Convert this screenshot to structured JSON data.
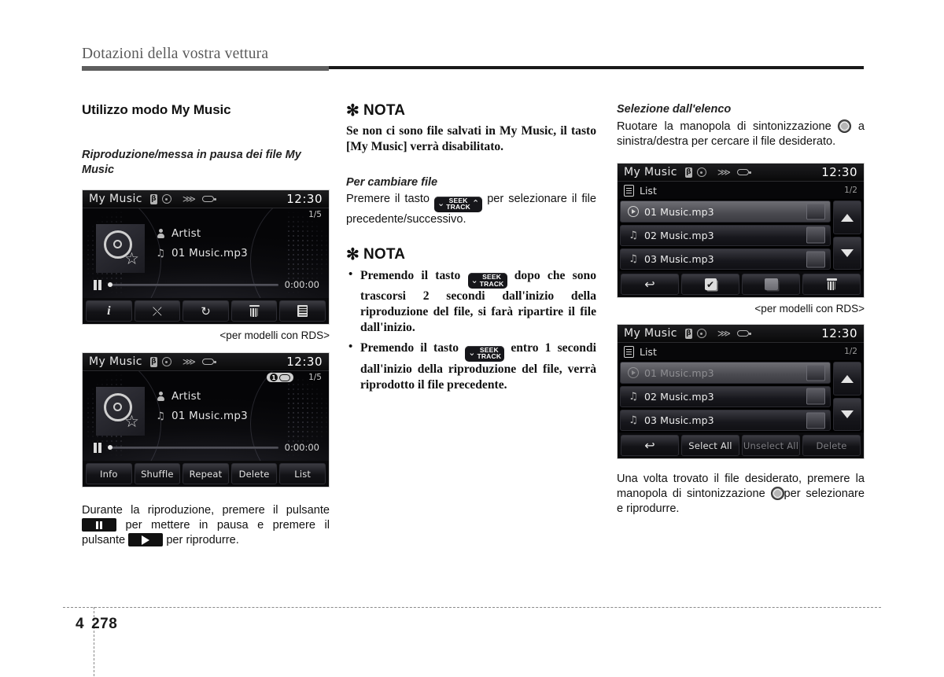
{
  "header": {
    "title": "Dotazioni della vostra vettura"
  },
  "footer": {
    "section": "4",
    "page": "278"
  },
  "left": {
    "section_title": "Utilizzo modo My Music",
    "sub_title": "Riproduzione/messa in pausa dei file My Music",
    "caption_rds": "<per modelli con RDS>",
    "bottom_text_1": "Durante la riproduzione, premere il pulsante",
    "bottom_text_2": "per mettere in pausa e premere il pulsante",
    "bottom_text_3": "per riprodurre."
  },
  "middle": {
    "nota1_label": "NOTA",
    "nota1_text": "Se non ci sono file salvati in My Music, il tasto [My Music] verrà disabilitato.",
    "sub_title": "Per cambiare file",
    "change_text_1": "Premere il tasto",
    "change_text_2": "per selezionare il file precedente/successivo.",
    "nota2_label": "NOTA",
    "bullet1_a": "Premendo il tasto",
    "bullet1_b": "dopo che sono trascorsi 2 secondi dall'inizio della riproduzione del file, si farà ripartire il file dall'inizio.",
    "bullet2_a": "Premendo il tasto",
    "bullet2_b": "entro 1 secondi dall'inizio della riproduzione del file, verrà riprodotto il file precedente.",
    "seek_line1": "SEEK",
    "seek_line2": "TRACK",
    "chevron_down": "⌄",
    "chevron_up": "⌃"
  },
  "right": {
    "sub_title": "Selezione dall'elenco",
    "text_1": "Ruotare la manopola di sintonizzazione",
    "text_2": "a sinistra/destra per cercare il file desiderato.",
    "caption_rds": "<per modelli con RDS>",
    "bottom_text_1": "Una volta trovato il file desiderato, premere la manopola di sintonizzazione",
    "bottom_text_2": "per selezionare e riprodurre."
  },
  "screens": {
    "player_rds": {
      "title": "My Music",
      "clock": "12:30",
      "track_index": "1/5",
      "artist": "Artist",
      "track": "01 Music.mp3",
      "time": "0:00:00",
      "buttons": [
        {
          "name": "info",
          "glyph": "i"
        },
        {
          "name": "shuffle",
          "glyph": "⤨"
        },
        {
          "name": "repeat",
          "glyph": "↺"
        },
        {
          "name": "delete",
          "glyph": "trash"
        },
        {
          "name": "list",
          "glyph": "list"
        }
      ],
      "icons": {
        "bluetooth": "bluetooth-icon",
        "disc": "disc-icon",
        "usb": "usb-icon",
        "device": "device-icon"
      }
    },
    "player_labels": {
      "title": "My Music",
      "clock": "12:30",
      "track_index": "1/5",
      "repeat_one_badge": "1",
      "artist": "Artist",
      "track": "01 Music.mp3",
      "time": "0:00:00",
      "buttons": [
        "Info",
        "Shuffle",
        "Repeat",
        "Delete",
        "List"
      ]
    },
    "list_rds": {
      "title": "My Music",
      "clock": "12:30",
      "list_label": "List",
      "page": "1/2",
      "rows": [
        {
          "label": "01 Music.mp3",
          "icon": "play-circle-icon",
          "selected": true
        },
        {
          "label": "02 Music.mp3",
          "icon": "music-note-icon",
          "selected": false
        },
        {
          "label": "03 Music.mp3",
          "icon": "music-note-icon",
          "selected": false
        }
      ],
      "scroll_up": "▲",
      "scroll_down": "▼",
      "buttons": [
        {
          "name": "back",
          "glyph": "↩"
        },
        {
          "name": "select-all",
          "glyph": "checkbox"
        },
        {
          "name": "unselect-all",
          "glyph": "square"
        },
        {
          "name": "delete",
          "glyph": "trash"
        }
      ]
    },
    "list_labels": {
      "title": "My Music",
      "clock": "12:30",
      "list_label": "List",
      "page": "1/2",
      "rows": [
        {
          "label": "01 Music.mp3",
          "icon": "play-circle-icon",
          "dim": true
        },
        {
          "label": "02 Music.mp3",
          "icon": "music-note-icon",
          "dim": false
        },
        {
          "label": "03 Music.mp3",
          "icon": "music-note-icon",
          "dim": false
        }
      ],
      "scroll_up": "▲",
      "scroll_down": "▼",
      "buttons": [
        "↩",
        "Select All",
        "Unselect All",
        "Delete"
      ]
    }
  },
  "colors": {
    "header_text": "#5a5a5a",
    "rule": "#1a1a1a",
    "screen_bg": "#000000",
    "screen_text": "#e8e8e8"
  }
}
